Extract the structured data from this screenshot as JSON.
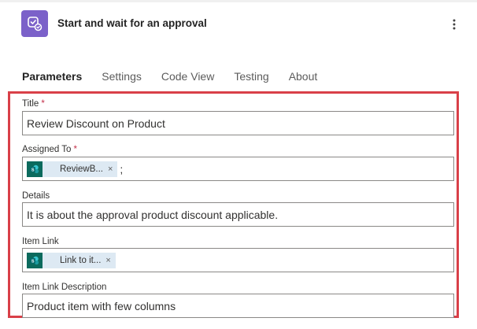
{
  "header": {
    "title": "Start and wait for an approval",
    "app_icon": "approval-icon",
    "more_icon": "more-vertical-icon"
  },
  "tabs": [
    {
      "label": "Parameters",
      "active": true
    },
    {
      "label": "Settings",
      "active": false
    },
    {
      "label": "Code View",
      "active": false
    },
    {
      "label": "Testing",
      "active": false
    },
    {
      "label": "About",
      "active": false
    }
  ],
  "fields": {
    "title": {
      "label": "Title",
      "required_mark": "*",
      "value": "Review Discount on Product"
    },
    "assigned_to": {
      "label": "Assigned To",
      "required_mark": "*",
      "token": {
        "label": "ReviewB...",
        "remove": "×",
        "icon": "sharepoint-icon"
      },
      "separator": ";"
    },
    "details": {
      "label": "Details",
      "value": "It is about the approval product discount applicable."
    },
    "item_link": {
      "label": "Item Link",
      "token": {
        "label": "Link to it...",
        "remove": "×",
        "icon": "sharepoint-icon"
      }
    },
    "item_link_description": {
      "label": "Item Link Description",
      "value": "Product item with few columns"
    }
  },
  "colors": {
    "accent_purple": "#7b61c9",
    "highlight_red": "#d94048",
    "required_red": "#c4314b",
    "sharepoint_teal": "#0b6a5d",
    "token_bg": "#dde9f3"
  }
}
